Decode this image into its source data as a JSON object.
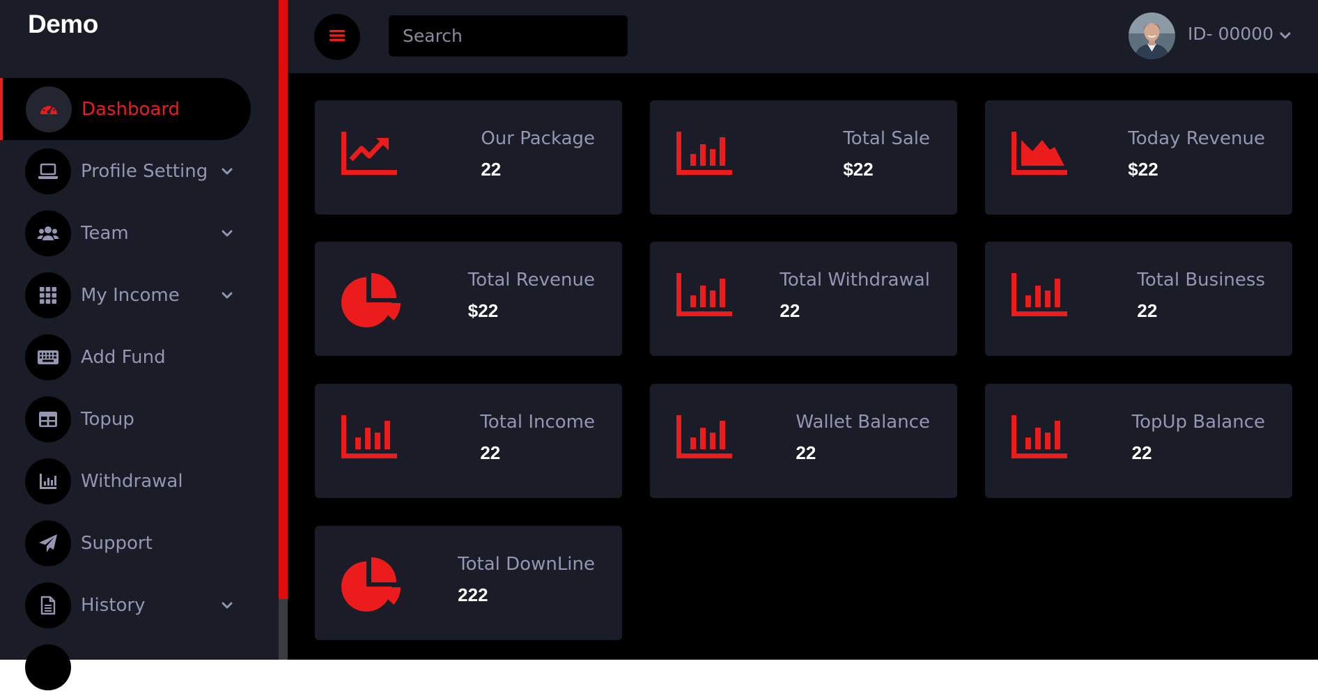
{
  "brand": "Demo",
  "sidebar": {
    "items": [
      {
        "label": "Dashboard",
        "icon": "speedometer-icon",
        "active": true,
        "has_submenu": false
      },
      {
        "label": "Profile Setting",
        "icon": "laptop-icon",
        "active": false,
        "has_submenu": true
      },
      {
        "label": "Team",
        "icon": "users-icon",
        "active": false,
        "has_submenu": true
      },
      {
        "label": "My Income",
        "icon": "grid-icon",
        "active": false,
        "has_submenu": true
      },
      {
        "label": "Add Fund",
        "icon": "keyboard-icon",
        "active": false,
        "has_submenu": false
      },
      {
        "label": "Topup",
        "icon": "table-icon",
        "active": false,
        "has_submenu": false
      },
      {
        "label": "Withdrawal",
        "icon": "chart-icon",
        "active": false,
        "has_submenu": false
      },
      {
        "label": "Support",
        "icon": "paper-plane-icon",
        "active": false,
        "has_submenu": false
      },
      {
        "label": "History",
        "icon": "document-icon",
        "active": false,
        "has_submenu": true
      }
    ]
  },
  "header": {
    "search_placeholder": "Search",
    "user_id": "ID- 00000"
  },
  "cards": [
    {
      "label": "Our Package",
      "value": "22",
      "icon": "line-chart-icon"
    },
    {
      "label": "Total Sale",
      "value": "$22",
      "icon": "bar-chart-icon"
    },
    {
      "label": "Today Revenue",
      "value": "$22",
      "icon": "area-chart-icon"
    },
    {
      "label": "Total Revenue",
      "value": "$22",
      "icon": "pie-chart-icon"
    },
    {
      "label": "Total Withdrawal",
      "value": "22",
      "icon": "bar-chart-icon"
    },
    {
      "label": "Total Business",
      "value": "22",
      "icon": "bar-chart-icon"
    },
    {
      "label": "Total Income",
      "value": "22",
      "icon": "bar-chart-icon"
    },
    {
      "label": "Wallet Balance",
      "value": "22",
      "icon": "bar-chart-icon"
    },
    {
      "label": "TopUp Balance",
      "value": "22",
      "icon": "bar-chart-icon"
    },
    {
      "label": "Total DownLine",
      "value": "222",
      "icon": "pie-chart-icon"
    }
  ],
  "colors": {
    "accent": "#ed1c1c",
    "panel": "#1a1c27",
    "background": "#000000",
    "muted_text": "#9496b3"
  }
}
